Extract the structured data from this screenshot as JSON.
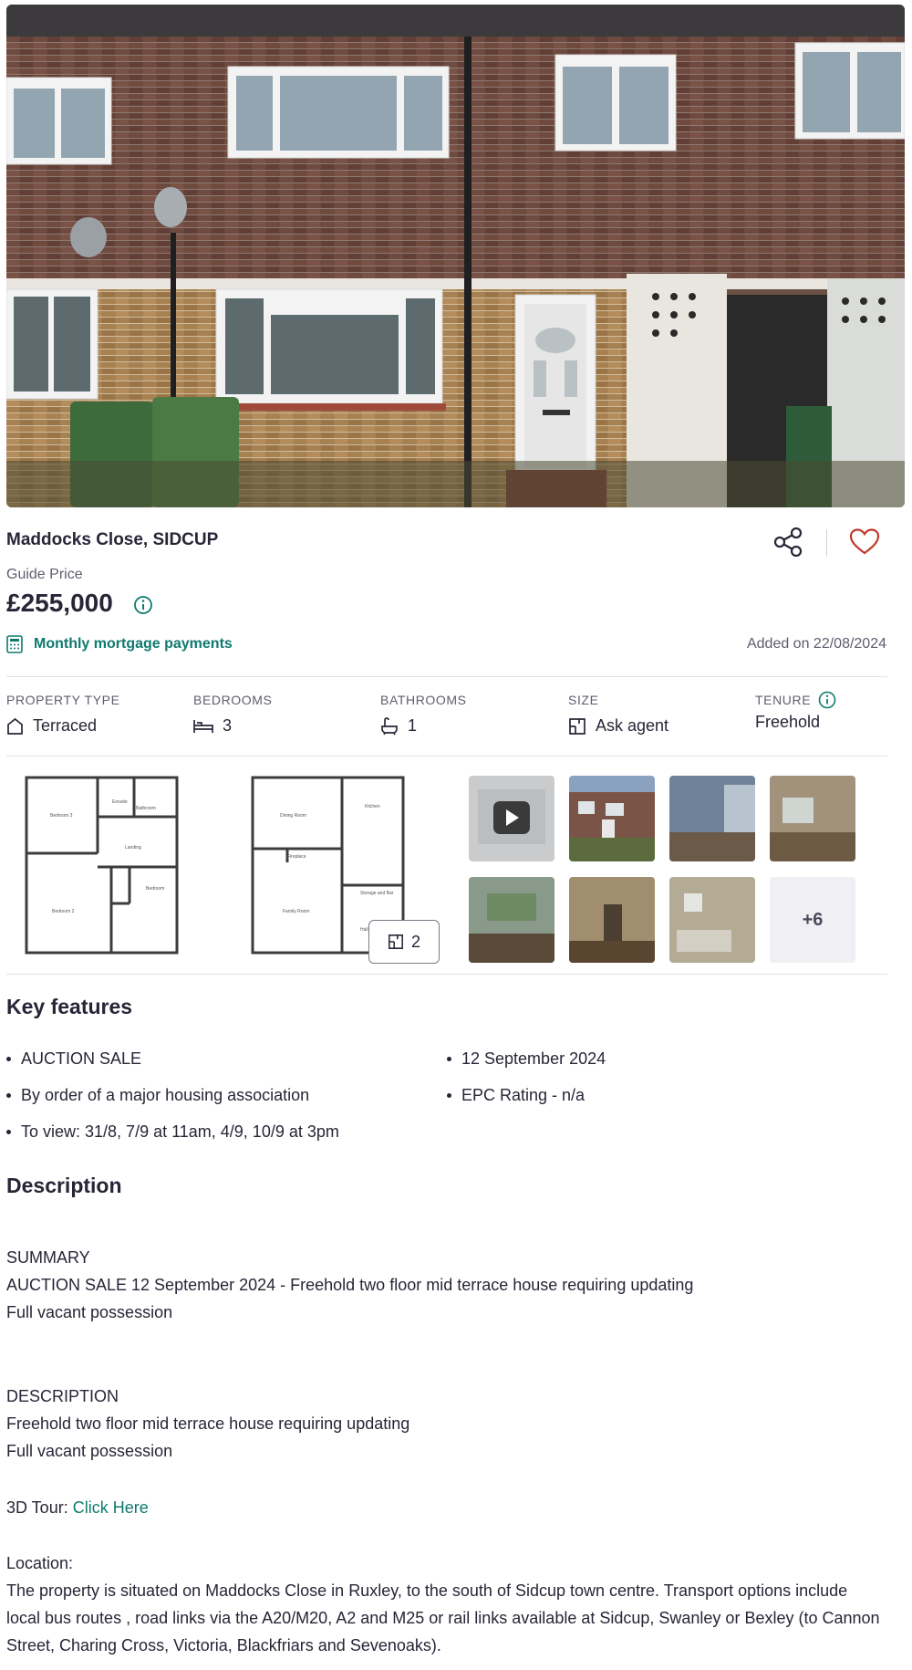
{
  "listing": {
    "address": "Maddocks Close, SIDCUP",
    "price_label": "Guide Price",
    "price": "£255,000",
    "mortgage_link": "Monthly mortgage payments",
    "added": "Added on 22/08/2024"
  },
  "facts": [
    {
      "label": "PROPERTY TYPE",
      "value": "Terraced",
      "icon": "house-icon"
    },
    {
      "label": "BEDROOMS",
      "value": "3",
      "icon": "bed-icon"
    },
    {
      "label": "BATHROOMS",
      "value": "1",
      "icon": "bath-icon"
    },
    {
      "label": "SIZE",
      "value": "Ask agent",
      "icon": "floorplan-icon"
    },
    {
      "label": "TENURE",
      "value": "Freehold",
      "icon": "info-icon"
    }
  ],
  "floorplans": {
    "count": "2",
    "plan1_rooms": [
      "Bedroom 3",
      "Ensuite",
      "Bathroom",
      "Landing",
      "Bedroom",
      "Bedroom 2"
    ],
    "plan2_rooms": [
      "Dining Room",
      "Kitchen",
      "Fireplace",
      "Family Room",
      "Storage and Bar",
      "Hall"
    ]
  },
  "gallery": {
    "more": "+6"
  },
  "key_features": {
    "heading": "Key features",
    "items": [
      "AUCTION SALE",
      "12 September 2024",
      "By order of a major housing association",
      "EPC Rating - n/a",
      "To view: 31/8, 7/9 at 11am, 4/9, 10/9 at 3pm"
    ]
  },
  "description": {
    "heading": "Description",
    "summary_head": "SUMMARY",
    "summary_line1": "AUCTION SALE 12 September 2024 - Freehold two floor mid terrace house requiring updating",
    "summary_line2": "Full vacant possession",
    "desc_head": "DESCRIPTION",
    "desc_line1": "Freehold two floor mid terrace house requiring updating",
    "desc_line2": "Full vacant possession",
    "tour_label": "3D Tour: ",
    "tour_link": "Click Here",
    "location_label": "Location:",
    "location_text": "The property is situated on Maddocks Close in Ruxley, to the south of Sidcup town centre. Transport options include local bus routes , road links via the A20/M20, A2 and M25 or rail links available at Sidcup, Swanley or Bexley (to Cannon Street, Charing Cross, Victoria, Blackfriars and Sevenoaks)."
  },
  "colors": {
    "accent": "#0e7a6e",
    "text": "#262637",
    "muted": "#5e5e6e",
    "heart": "#c0392b"
  }
}
